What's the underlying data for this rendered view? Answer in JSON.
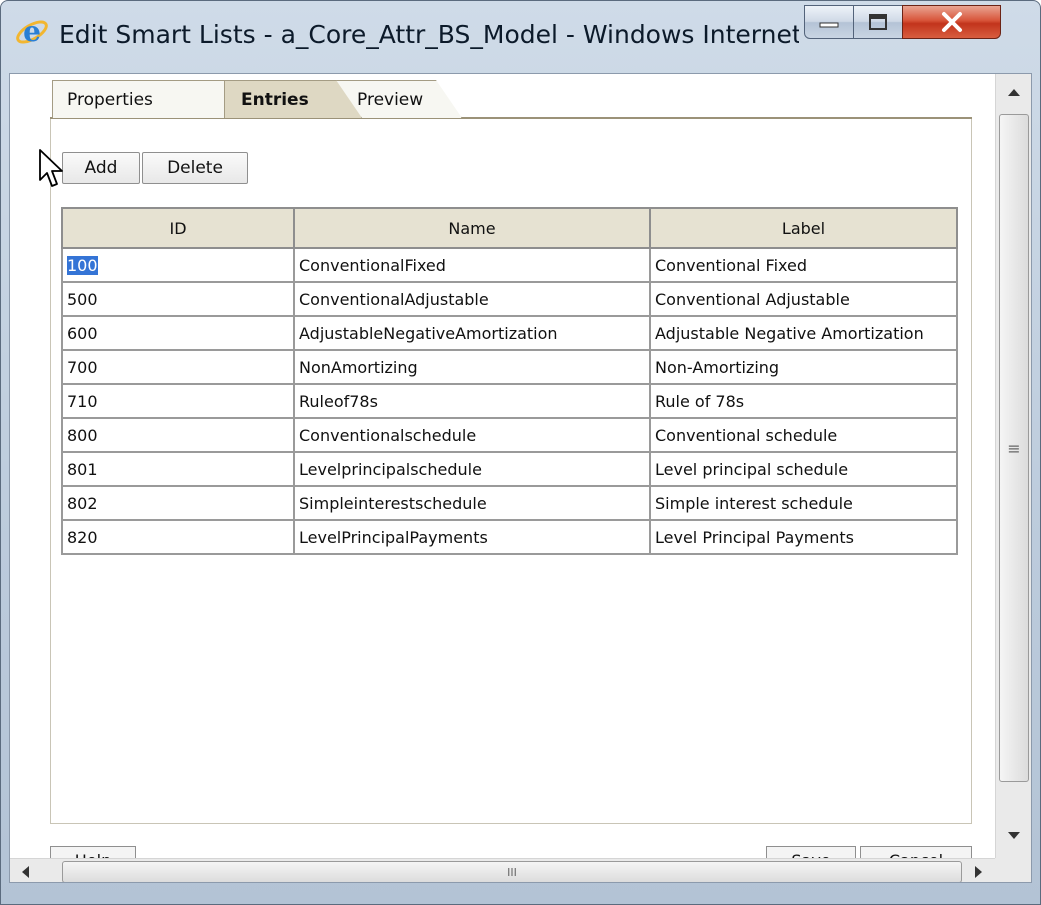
{
  "window": {
    "title": "Edit Smart Lists - a_Core_Attr_BS_Model - Windows Internet...",
    "app_icon": "internet-explorer-icon",
    "controls": [
      "minimize-icon",
      "maximize-icon",
      "close-icon"
    ]
  },
  "tabs": [
    {
      "label": "Properties",
      "active": false
    },
    {
      "label": "Entries",
      "active": true
    },
    {
      "label": "Preview",
      "active": false
    }
  ],
  "toolbar": {
    "add_label": "Add",
    "delete_label": "Delete"
  },
  "table": {
    "columns": [
      "ID",
      "Name",
      "Label"
    ],
    "rows": [
      {
        "id": "100",
        "name": "ConventionalFixed",
        "label": "Conventional Fixed",
        "selected": true
      },
      {
        "id": "500",
        "name": "ConventionalAdjustable",
        "label": "Conventional Adjustable"
      },
      {
        "id": "600",
        "name": "AdjustableNegativeAmortization",
        "label": "Adjustable Negative Amortization"
      },
      {
        "id": "700",
        "name": "NonAmortizing",
        "label": "Non-Amortizing"
      },
      {
        "id": "710",
        "name": "Ruleof78s",
        "label": "Rule of 78s"
      },
      {
        "id": "800",
        "name": "Conventionalschedule",
        "label": "Conventional schedule"
      },
      {
        "id": "801",
        "name": "Levelprincipalschedule",
        "label": "Level principal schedule"
      },
      {
        "id": "802",
        "name": "Simpleinterestschedule",
        "label": "Simple interest schedule"
      },
      {
        "id": "820",
        "name": "LevelPrincipalPayments",
        "label": "Level Principal Payments"
      }
    ]
  },
  "footer": {
    "help_label": "Help",
    "save_label": "Save",
    "cancel_label": "Cancel"
  },
  "scrollbar": {
    "grip": "≡",
    "h_grip": "III"
  },
  "colors": {
    "selection": "#3474d6",
    "header_bg": "#e6e2d2",
    "close_button": "#c2341c"
  }
}
